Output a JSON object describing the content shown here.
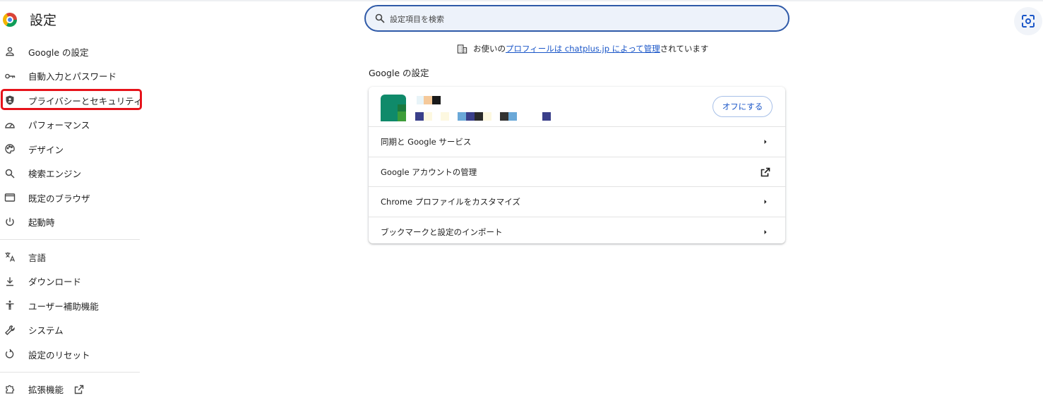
{
  "app": {
    "title": "設定"
  },
  "search": {
    "placeholder": "設定項目を検索"
  },
  "sidebar": {
    "items": [
      {
        "label": "Google の設定",
        "icon": "person-icon"
      },
      {
        "label": "自動入力とパスワード",
        "icon": "key-icon"
      },
      {
        "label": "プライバシーとセキュリティ",
        "icon": "shield-icon"
      },
      {
        "label": "パフォーマンス",
        "icon": "speedometer-icon"
      },
      {
        "label": "デザイン",
        "icon": "palette-icon"
      },
      {
        "label": "検索エンジン",
        "icon": "search-icon"
      },
      {
        "label": "既定のブラウザ",
        "icon": "browser-window-icon"
      },
      {
        "label": "起動時",
        "icon": "power-icon"
      },
      {
        "label": "言語",
        "icon": "translate-icon"
      },
      {
        "label": "ダウンロード",
        "icon": "download-icon"
      },
      {
        "label": "ユーザー補助機能",
        "icon": "accessibility-icon"
      },
      {
        "label": "システム",
        "icon": "wrench-icon"
      },
      {
        "label": "設定のリセット",
        "icon": "reset-icon"
      },
      {
        "label": "拡張機能",
        "icon": "puzzle-icon"
      }
    ],
    "highlight_color": "#e6131b"
  },
  "notice": {
    "prefix": "お使いの",
    "link_text": "プロフィールは chatplus.jp によって管理",
    "suffix": "されています"
  },
  "section": {
    "title": "Google の設定"
  },
  "card": {
    "turn_off_label": "オフにする",
    "rows": [
      {
        "label": "同期と Google サービス",
        "icon": "chevron-right-icon"
      },
      {
        "label": "Google アカウントの管理",
        "icon": "external-link-icon"
      },
      {
        "label": "Chrome プロファイルをカスタマイズ",
        "icon": "chevron-right-icon"
      },
      {
        "label": "ブックマークと設定のインポート",
        "icon": "chevron-right-icon"
      }
    ]
  },
  "colors": {
    "accent": "#1a56c8",
    "search_border": "#2f5aa8",
    "search_bg": "#edf2fa"
  }
}
